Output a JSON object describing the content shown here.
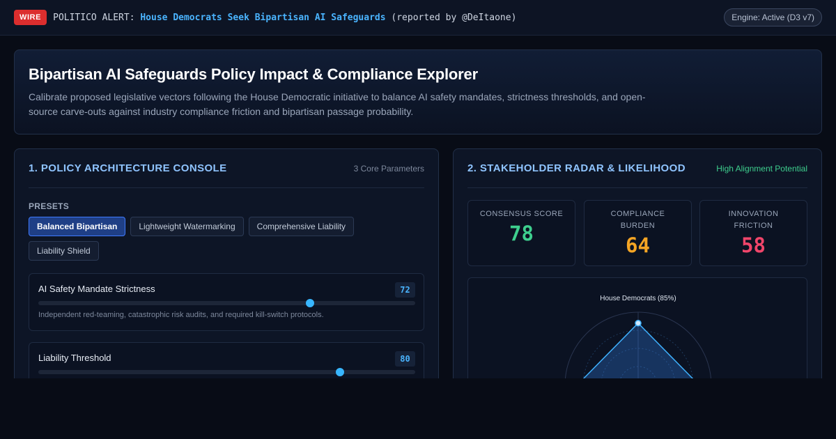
{
  "alert": {
    "badge": "WIRE",
    "prefix": "POLITICO ALERT: ",
    "headline": "House Democrats Seek Bipartisan AI Safeguards",
    "reporter": " (reported by @DeItaone)"
  },
  "engine_status": "Engine: Active (D3 v7)",
  "hero": {
    "title": "Bipartisan AI Safeguards Policy Impact & Compliance Explorer",
    "description": "Calibrate proposed legislative vectors following the House Democratic initiative to balance AI safety mandates, strictness thresholds, and open-source carve-outs against industry compliance friction and bipartisan passage probability."
  },
  "console": {
    "title": "1. Policy Architecture Console",
    "meta": "3 Core Parameters",
    "presets_label": "PRESETS",
    "presets": [
      {
        "label": "Balanced Bipartisan",
        "active": true
      },
      {
        "label": "Lightweight Watermarking",
        "active": false
      },
      {
        "label": "Comprehensive Liability",
        "active": false
      },
      {
        "label": "Liability Shield",
        "active": false
      }
    ],
    "params": [
      {
        "name": "AI Safety Mandate Strictness",
        "value": 72,
        "desc": "Independent red-teaming, catastrophic risk audits, and required kill-switch protocols."
      },
      {
        "name": "Liability Threshold",
        "value": 80,
        "desc": ""
      }
    ]
  },
  "radar_panel": {
    "title": "2. Stakeholder Radar & Likelihood",
    "meta": "High Alignment Potential",
    "meta_color": "#3ecf8e",
    "stats": [
      {
        "label": "Consensus Score",
        "value": 78,
        "color": "#3ecf8e"
      },
      {
        "label": "Compliance Burden",
        "value": 64,
        "color": "#f5a524"
      },
      {
        "label": "Innovation Friction",
        "value": 58,
        "color": "#f0456a"
      }
    ],
    "radar": {
      "axis_label": "House Democrats (85%)",
      "value": 85
    }
  }
}
